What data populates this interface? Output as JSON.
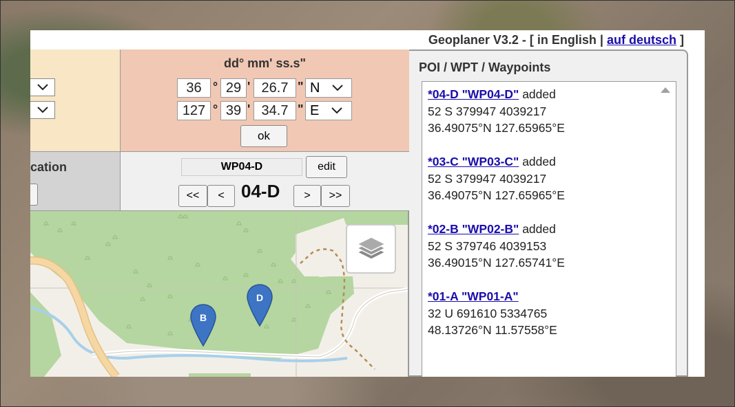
{
  "header": {
    "app_title": "Geoplaner V3.2 - [ in English |",
    "lang_link": "auf deutsch",
    "bracket_close": "]"
  },
  "coords": {
    "title": "dd° mm' ss.s\"",
    "lat": {
      "deg": "36",
      "min": "29",
      "sec": "26.7",
      "hemi": "N"
    },
    "lon": {
      "deg": "127",
      "min": "39",
      "sec": "34.7",
      "hemi": "E"
    },
    "deg_sym": "°",
    "min_sym": "'",
    "sec_sym": "\"",
    "ok_label": "ok"
  },
  "location": {
    "label": "cation"
  },
  "waypoint_nav": {
    "name": "WP04-D",
    "edit_label": "edit",
    "first_label": "<<",
    "prev_label": "<",
    "current_id": "04-D",
    "next_label": ">",
    "last_label": ">>"
  },
  "map": {
    "markers": [
      {
        "label": "B"
      },
      {
        "label": "D"
      }
    ]
  },
  "poi": {
    "title": "POI / WPT / Waypoints",
    "entries": [
      {
        "link": "*04-D \"WP04-D\"",
        "status": " added",
        "utm": "52 S 379947 4039217",
        "latlon": "36.49075°N 127.65965°E"
      },
      {
        "link": "*03-C \"WP03-C\"",
        "status": " added",
        "utm": "52 S 379947 4039217",
        "latlon": "36.49075°N 127.65965°E"
      },
      {
        "link": "*02-B \"WP02-B\"",
        "status": " added",
        "utm": "52 S 379746 4039153",
        "latlon": "36.49015°N 127.65741°E"
      },
      {
        "link": "*01-A \"WP01-A\"",
        "status": "",
        "utm": "32 U 691610 5334765",
        "latlon": "48.13726°N 11.57558°E"
      }
    ]
  },
  "colors": {
    "beige": "#f8e6c5",
    "salmon": "#f1c8b4",
    "map_green": "#b5d6a0",
    "marker_blue": "#3d74c4",
    "link": "#1a0dab"
  }
}
